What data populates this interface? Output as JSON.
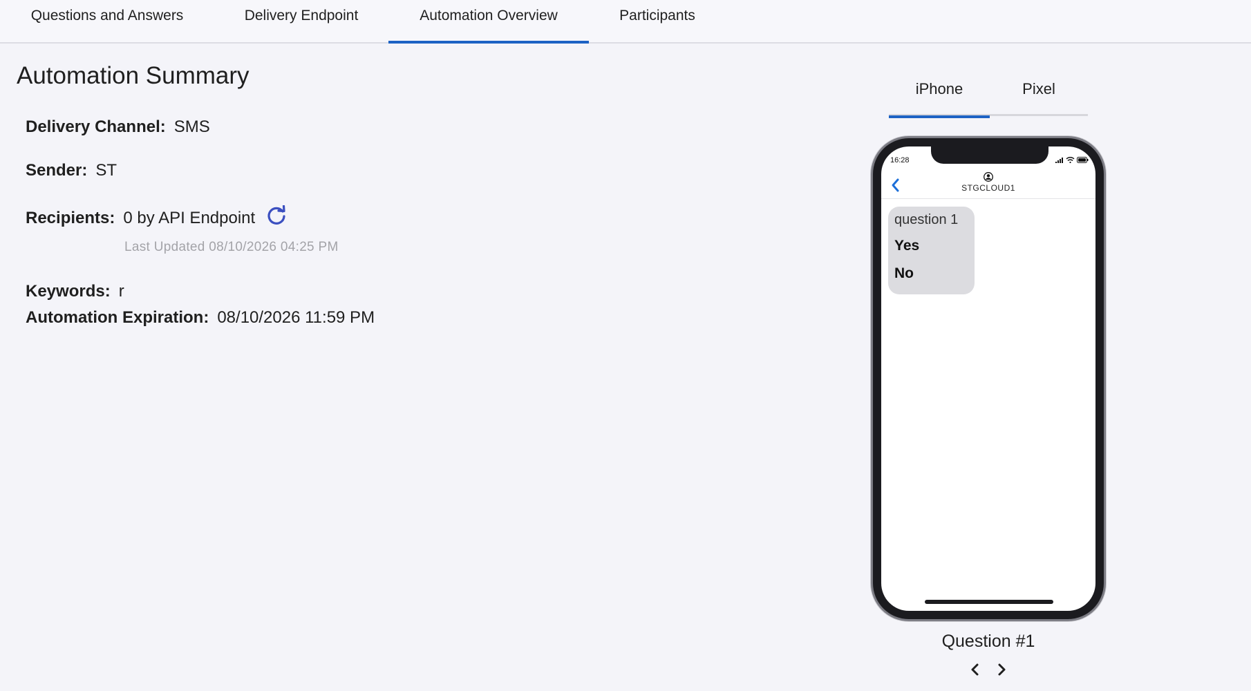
{
  "tabs": [
    {
      "label": "Questions and Answers",
      "active": false
    },
    {
      "label": "Delivery Endpoint",
      "active": false
    },
    {
      "label": "Automation Overview",
      "active": true
    },
    {
      "label": "Participants",
      "active": false
    }
  ],
  "summary": {
    "title": "Automation Summary",
    "delivery_channel": {
      "label": "Delivery Channel:",
      "value": "SMS"
    },
    "sender": {
      "label": "Sender:",
      "value": "ST"
    },
    "recipients": {
      "label": "Recipients:",
      "value": "0 by API Endpoint",
      "icon": "refresh-icon"
    },
    "last_updated": "Last Updated 08/10/2026 04:25 PM",
    "keywords": {
      "label": "Keywords:",
      "value": "r"
    },
    "expiration": {
      "label": "Automation Expiration:",
      "value": "08/10/2026 11:59 PM"
    }
  },
  "device_tabs": [
    {
      "label": "iPhone",
      "active": true
    },
    {
      "label": "Pixel",
      "active": false
    }
  ],
  "phone": {
    "status_time": "16:28",
    "contact_name": "STGCLOUD1",
    "message": {
      "question": "question 1",
      "options": [
        "Yes",
        "No"
      ]
    }
  },
  "preview": {
    "question_label": "Question #1"
  },
  "colors": {
    "accent": "#1d62c4",
    "refresh_icon": "#3b4fc0",
    "bubble": "#dcdce0",
    "background": "#f4f4f9"
  }
}
